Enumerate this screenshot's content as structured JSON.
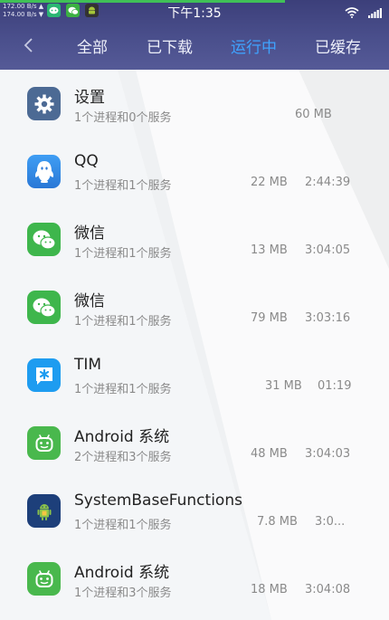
{
  "status_bar": {
    "upload_speed": "172.00 B/s ▲",
    "download_speed": "174.00 B/s ▼",
    "time": "下午1:35",
    "notification_icons": [
      "message-app-icon",
      "wechat-icon",
      "android-icon"
    ],
    "system_icons": [
      "wifi-icon",
      "signal-icon"
    ]
  },
  "tabs": {
    "back_icon": "back-arrow-icon",
    "items": [
      {
        "label": "全部",
        "active": false
      },
      {
        "label": "已下载",
        "active": false
      },
      {
        "label": "运行中",
        "active": true
      },
      {
        "label": "已缓存",
        "active": false
      }
    ]
  },
  "apps": [
    {
      "name": "设置",
      "desc": "1个进程和0个服务",
      "memory": "60 MB",
      "time": "",
      "icon": "settings-gear-icon"
    },
    {
      "name": "QQ",
      "desc": "1个进程和1个服务",
      "memory": "22 MB",
      "time": "2:44:39",
      "icon": "qq-icon"
    },
    {
      "name": "微信",
      "desc": "1个进程和1个服务",
      "memory": "13 MB",
      "time": "3:04:05",
      "icon": "wechat-icon"
    },
    {
      "name": "微信",
      "desc": "1个进程和1个服务",
      "memory": "79 MB",
      "time": "3:03:16",
      "icon": "wechat-icon"
    },
    {
      "name": "TIM",
      "desc": "1个进程和1个服务",
      "memory": "31 MB",
      "time": "01:19",
      "icon": "tim-icon"
    },
    {
      "name": "Android 系统",
      "desc": "2个进程和3个服务",
      "memory": "48 MB",
      "time": "3:04:03",
      "icon": "android-system-icon"
    },
    {
      "name": "SystemBaseFunctions",
      "desc": "1个进程和1个服务",
      "memory": "7.8 MB",
      "time": "3:0...",
      "icon": "system-base-functions-icon"
    },
    {
      "name": "Android 系统",
      "desc": "1个进程和3个服务",
      "memory": "18 MB",
      "time": "3:04:08",
      "icon": "android-system-icon"
    }
  ],
  "colors": {
    "header": "#4a4f8c",
    "active_tab": "#3fa3ff",
    "progress": "#40c057"
  }
}
